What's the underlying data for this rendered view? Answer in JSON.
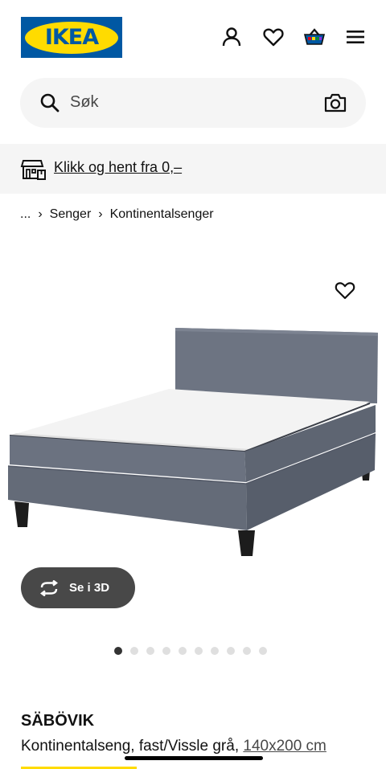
{
  "header": {
    "logo_text": "IKEA",
    "icons": [
      "account-icon",
      "heart-icon",
      "basket-icon",
      "menu-icon"
    ]
  },
  "search": {
    "placeholder": "Søk",
    "icons": [
      "search-icon",
      "camera-icon"
    ]
  },
  "banner": {
    "text": "Klikk og hent fra 0,–",
    "icon": "store-pickup-icon"
  },
  "breadcrumb": {
    "items": [
      "...",
      "Senger",
      "Kontinentalsenger"
    ]
  },
  "gallery": {
    "button_3d_label": "Se i 3D",
    "dot_count": 10,
    "active_dot": 0
  },
  "product": {
    "name": "SÄBÖVIK",
    "description": "Kontinentalseng, fast/Vissle grå,",
    "size": "140x200 cm"
  },
  "colors": {
    "brand_blue": "#0058a3",
    "brand_yellow": "#ffdb00",
    "bed_fabric": "#6d7482",
    "button_dark": "#484848"
  }
}
